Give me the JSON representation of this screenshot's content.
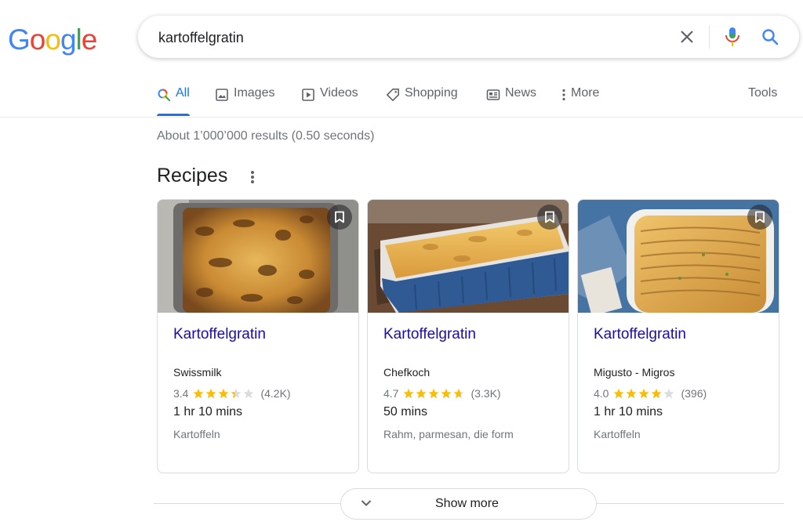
{
  "logo": {
    "letters": [
      {
        "ch": "G",
        "color": "#4285F4"
      },
      {
        "ch": "o",
        "color": "#EA4335"
      },
      {
        "ch": "o",
        "color": "#FBBC05"
      },
      {
        "ch": "g",
        "color": "#4285F4"
      },
      {
        "ch": "l",
        "color": "#34A853"
      },
      {
        "ch": "e",
        "color": "#EA4335"
      }
    ]
  },
  "search": {
    "query": "kartoffelgratin",
    "clear_icon": "close-icon",
    "mic_icon": "microphone-icon",
    "search_icon": "search-icon"
  },
  "tabs": [
    {
      "label": "All",
      "icon": "search-icon",
      "active": true
    },
    {
      "label": "Images",
      "icon": "image-icon",
      "active": false
    },
    {
      "label": "Videos",
      "icon": "video-icon",
      "active": false
    },
    {
      "label": "Shopping",
      "icon": "tag-icon",
      "active": false
    },
    {
      "label": "News",
      "icon": "newspaper-icon",
      "active": false
    },
    {
      "label": "More",
      "icon": "more-vert-icon",
      "active": false
    }
  ],
  "tools_label": "Tools",
  "result_stats": "About 1’000’000 results (0.50 seconds)",
  "recipes": {
    "heading": "Recipes",
    "cards": [
      {
        "title": "Kartoffelgratin",
        "source": "Swissmilk",
        "rating": "3.4",
        "rating_value": 3.4,
        "reviews": "(4.2K)",
        "time": "1 hr 10 mins",
        "ingredients": "Kartoffeln"
      },
      {
        "title": "Kartoffelgratin",
        "source": "Chefkoch",
        "rating": "4.7",
        "rating_value": 4.7,
        "reviews": "(3.3K)",
        "time": "50 mins",
        "ingredients": "Rahm, parmesan, die form"
      },
      {
        "title": "Kartoffelgratin",
        "source": "Migusto - Migros",
        "rating": "4.0",
        "rating_value": 4.0,
        "reviews": "(396)",
        "time": "1 hr 10 mins",
        "ingredients": "Kartoffeln"
      }
    ]
  },
  "show_more_label": "Show more",
  "colors": {
    "accent": "#1a73e8",
    "link": "#1a0dab",
    "star": "#fbbc04",
    "star_empty": "#dadce0"
  }
}
